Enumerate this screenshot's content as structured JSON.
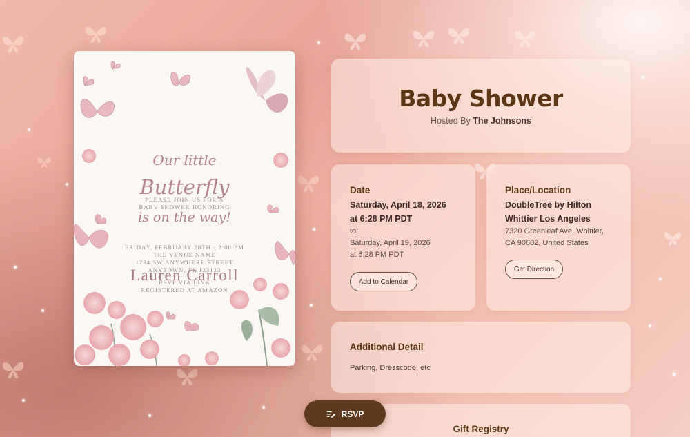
{
  "colors": {
    "brand_brown": "#5b3717",
    "rsvp_bg": "#5d3a1f",
    "card_bg": "rgba(255,238,230,0.55)",
    "invite_text": "#a87b86"
  },
  "invitation": {
    "script_line1": "Our little",
    "script_line2": "Butterfly",
    "script_line3": "is on the way!",
    "please_join": "PLEASE JOIN US FOR A",
    "shower_honoring": "BABY SHOWER HONORING",
    "honoree": "Lauren Carroll",
    "date_line": "FRIDAY, FEBRUARY 28TH - 2:00 PM",
    "venue": "THE VENUE NAME",
    "street": "1234 SW ANYWHERE STREET",
    "city": "ANYTOWN, FL 123123",
    "rsvp_line": "RSVP VIA LINK",
    "registry_line": "REGISTERED AT AMAZON"
  },
  "event": {
    "title": "Baby Shower",
    "hosted_prefix": "Hosted By",
    "host": "The Johnsons"
  },
  "date_card": {
    "heading": "Date",
    "start_date": "Saturday, April 18, 2026",
    "start_time": "at 6:28 PM PDT",
    "to": "to",
    "end_date": "Saturday, April 19, 2026",
    "end_time": "at 6:28 PM PDT",
    "button": "Add to Calendar"
  },
  "place_card": {
    "heading": "Place/Location",
    "venue_line1": "DoubleTree by Hilton",
    "venue_line2": "Whittier Los Angeles",
    "address_line1": "7320 Greenleaf Ave, Whittier,",
    "address_line2": "CA 90602, United States",
    "button": "Get Direction"
  },
  "detail_card": {
    "heading": "Additional Detail",
    "text": "Parking, Dresscode, etc"
  },
  "gift_card": {
    "heading": "Gift Registry"
  },
  "rsvp": {
    "label": "RSVP",
    "icon": "edit-list-icon"
  }
}
